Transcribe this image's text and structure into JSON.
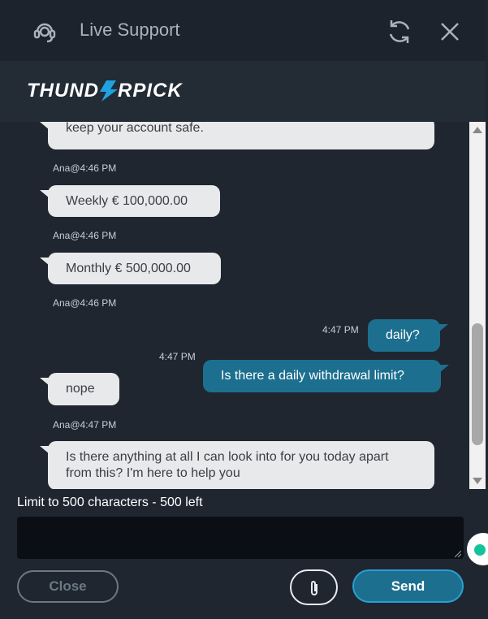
{
  "header": {
    "title": "Live Support",
    "support_icon": "headset-icon",
    "refresh_icon": "refresh-icon",
    "close_icon": "close-icon"
  },
  "brand": {
    "logo_text": "THUNDERPICK",
    "accent": "#1fa3e0"
  },
  "chat": {
    "messages": [
      {
        "from": "agent",
        "text": "keep your account safe.",
        "stamp": "Ana@4:46 PM"
      },
      {
        "from": "agent",
        "text": "Weekly  € 100,000.00",
        "stamp": "Ana@4:46 PM"
      },
      {
        "from": "agent",
        "text": "Monthly € 500,000.00",
        "stamp": "Ana@4:46 PM"
      },
      {
        "from": "user",
        "text": "daily?",
        "stamp": "4:47 PM"
      },
      {
        "from": "user",
        "text": "Is there a daily withdrawal limit?",
        "stamp": "4:47 PM"
      },
      {
        "from": "agent",
        "text": "nope",
        "stamp": "Ana@4:47 PM"
      },
      {
        "from": "agent",
        "text": "Is there anything at all I can look into for you today apart from this? I'm here to help you",
        "stamp": ""
      }
    ]
  },
  "composer": {
    "limit_text": "Limit to 500 characters - 500 left",
    "value": ""
  },
  "buttons": {
    "close_label": "Close",
    "send_label": "Send",
    "attach_icon": "paperclip-icon"
  },
  "colors": {
    "header_bg": "#1c232c",
    "panel_bg": "#1f2630",
    "user_bubble": "#1d6f8f",
    "agent_bubble": "#e8e9eb",
    "send_border": "#2a9fd0"
  }
}
